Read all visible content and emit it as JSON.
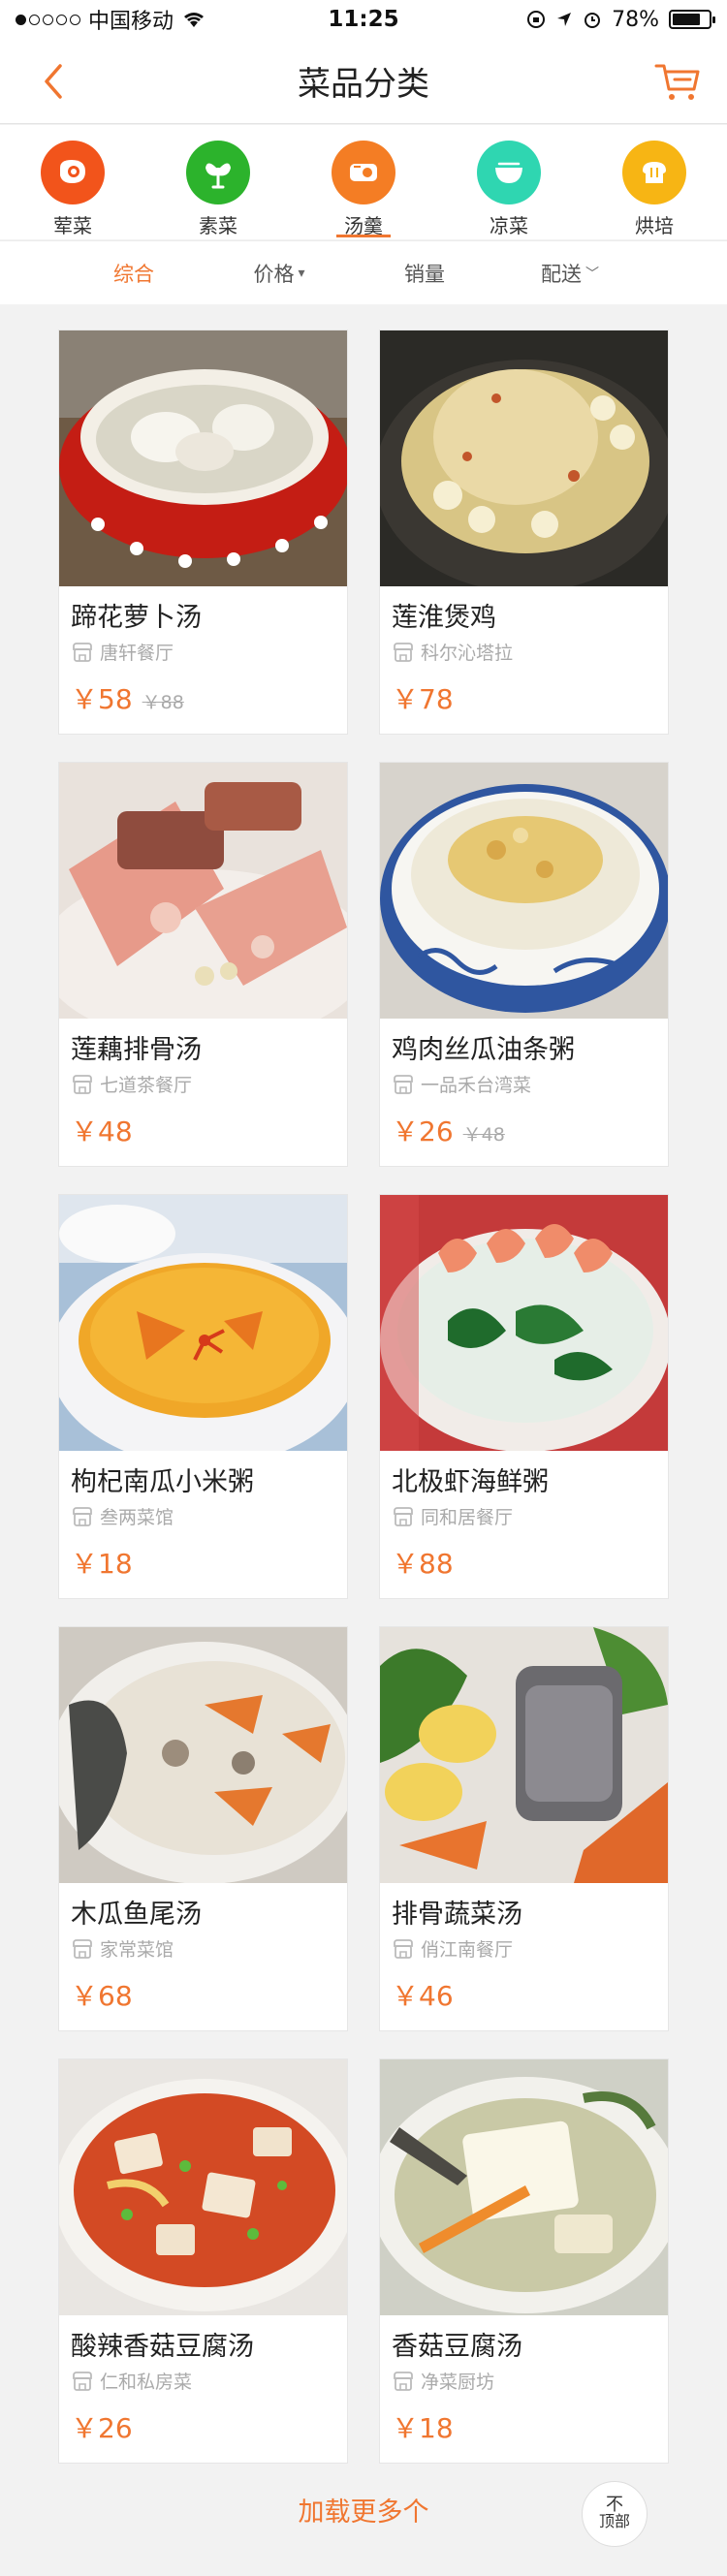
{
  "status_bar": {
    "carrier": "中国移动",
    "time": "11:25",
    "battery": "78%",
    "battery_level": 0.78
  },
  "header": {
    "title": "菜品分类",
    "back_icon": "chevron-left-icon",
    "cart_icon": "cart-icon"
  },
  "categories": [
    {
      "label": "荤菜",
      "icon": "meat-icon",
      "color": "#f2541b"
    },
    {
      "label": "素菜",
      "icon": "vegetable-icon",
      "color": "#2cb32c"
    },
    {
      "label": "汤羹",
      "icon": "soup-icon",
      "color": "#f47d24",
      "active": true
    },
    {
      "label": "凉菜",
      "icon": "bowl-icon",
      "color": "#2fd6b1"
    },
    {
      "label": "烘培",
      "icon": "bread-icon",
      "color": "#f7b514"
    }
  ],
  "sort_tabs": [
    {
      "label": "综合",
      "active": true
    },
    {
      "label": "价格",
      "indicator": "▾"
    },
    {
      "label": "销量"
    },
    {
      "label": "配送",
      "indicator": "﹀"
    }
  ],
  "dishes": [
    {
      "name": "蹄花萝卜汤",
      "shop": "唐轩餐厅",
      "price": "￥58",
      "old_price": "￥88"
    },
    {
      "name": "莲淮煲鸡",
      "shop": "科尔沁塔拉",
      "price": "￥78",
      "old_price": ""
    },
    {
      "name": "莲藕排骨汤",
      "shop": "七道茶餐厅",
      "price": "￥48",
      "old_price": ""
    },
    {
      "name": "鸡肉丝瓜油条粥",
      "shop": "一品禾台湾菜",
      "price": "￥26",
      "old_price": "￥48"
    },
    {
      "name": "枸杞南瓜小米粥",
      "shop": "叁两菜馆",
      "price": "￥18",
      "old_price": ""
    },
    {
      "name": "北极虾海鲜粥",
      "shop": "同和居餐厅",
      "price": "￥88",
      "old_price": ""
    },
    {
      "name": "木瓜鱼尾汤",
      "shop": "家常菜馆",
      "price": "￥68",
      "old_price": ""
    },
    {
      "name": "排骨蔬菜汤",
      "shop": "俏江南餐厅",
      "price": "￥46",
      "old_price": ""
    },
    {
      "name": "酸辣香菇豆腐汤",
      "shop": "仁和私房菜",
      "price": "￥26",
      "old_price": ""
    },
    {
      "name": "香菇豆腐汤",
      "shop": "净菜厨坊",
      "price": "￥18",
      "old_price": ""
    }
  ],
  "footer": {
    "load_more": "加载更多个",
    "to_top": "顶部",
    "to_top_arrow": "不"
  },
  "colors": {
    "accent": "#f07630"
  }
}
